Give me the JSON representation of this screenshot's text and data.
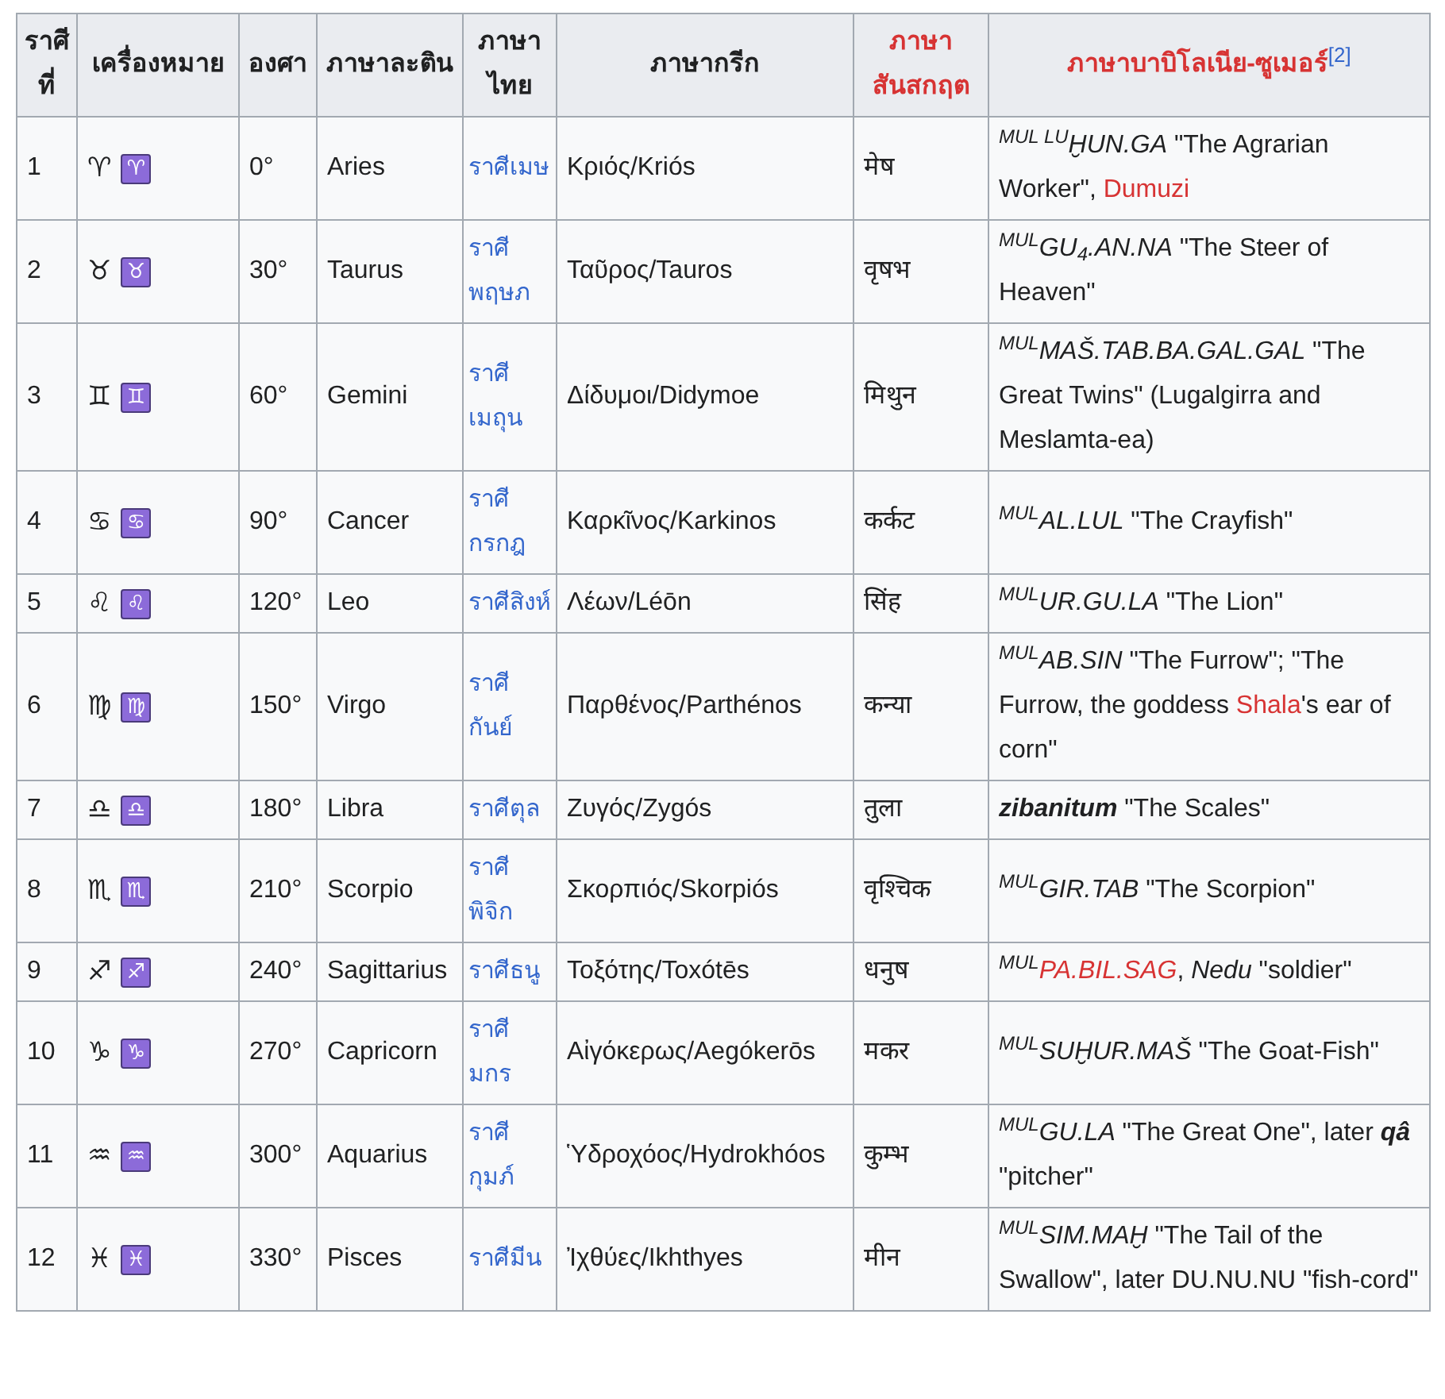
{
  "table": {
    "columns": [
      {
        "label": "ราศีที่",
        "kind": "plain"
      },
      {
        "label": "เครื่องหมาย",
        "kind": "plain"
      },
      {
        "label": "องศา",
        "kind": "plain"
      },
      {
        "label": "ภาษาละติน",
        "kind": "plain"
      },
      {
        "label": "ภาษาไทย",
        "kind": "plain"
      },
      {
        "label": "ภาษากรีก",
        "kind": "plain"
      },
      {
        "label": "ภาษาสันสกฤต",
        "kind": "redlink"
      },
      {
        "label": "ภาษาบาบิโลเนีย-ซูเมอร์",
        "kind": "redlink",
        "ref": "[2]"
      }
    ],
    "rows": [
      {
        "number": "1",
        "symbol": "♈",
        "emoji": "♈",
        "degree": "0°",
        "latin": "Aries",
        "thai": "ราศีเมษ",
        "greek": "Κριός/Kriós",
        "sanskrit": "मेष",
        "babylonian": [
          {
            "text": "MUL LU",
            "kind": "sup"
          },
          {
            "text": "ḪUN.GA",
            "kind": "italic"
          },
          {
            "text": " \"The Agrarian Worker\", ",
            "kind": "plain"
          },
          {
            "text": "Dumuzi",
            "kind": "link"
          }
        ]
      },
      {
        "number": "2",
        "symbol": "♉",
        "emoji": "♉",
        "degree": "30°",
        "latin": "Taurus",
        "thai": "ราศีพฤษภ",
        "greek": "Ταῦρος/Tauros",
        "sanskrit": "वृषभ",
        "babylonian": [
          {
            "text": "MUL",
            "kind": "sup"
          },
          {
            "text": "GU",
            "kind": "italic"
          },
          {
            "text": "4",
            "kind": "sub"
          },
          {
            "text": ".AN.NA",
            "kind": "italic"
          },
          {
            "text": " \"The Steer of Heaven\"",
            "kind": "plain"
          }
        ]
      },
      {
        "number": "3",
        "symbol": "♊",
        "emoji": "♊",
        "degree": "60°",
        "latin": "Gemini",
        "thai": "ราศีเมถุน",
        "greek": "Δίδυμοι/Didymoe",
        "sanskrit": "मिथुन",
        "babylonian": [
          {
            "text": "MUL",
            "kind": "sup"
          },
          {
            "text": "MAŠ.TAB.BA.GAL.GAL",
            "kind": "italic"
          },
          {
            "text": " \"The Great Twins\" (Lugalgirra and Meslamta-ea)",
            "kind": "plain"
          }
        ]
      },
      {
        "number": "4",
        "symbol": "♋",
        "emoji": "♋",
        "degree": "90°",
        "latin": "Cancer",
        "thai": "ราศีกรกฎ",
        "greek": "Καρκῖνος/Karkinos",
        "sanskrit": "कर्कट",
        "babylonian": [
          {
            "text": "MUL",
            "kind": "sup"
          },
          {
            "text": "AL.LUL",
            "kind": "italic"
          },
          {
            "text": " \"The Crayfish\"",
            "kind": "plain"
          }
        ]
      },
      {
        "number": "5",
        "symbol": "♌",
        "emoji": "♌",
        "degree": "120°",
        "latin": "Leo",
        "thai": "ราศีสิงห์",
        "greek": "Λέων/Léōn",
        "sanskrit": "सिंह",
        "babylonian": [
          {
            "text": "MUL",
            "kind": "sup"
          },
          {
            "text": "UR.GU.LA",
            "kind": "italic"
          },
          {
            "text": " \"The Lion\"",
            "kind": "plain"
          }
        ]
      },
      {
        "number": "6",
        "symbol": "♍",
        "emoji": "♍",
        "degree": "150°",
        "latin": "Virgo",
        "thai": "ราศีกันย์",
        "greek": "Παρθένος/Parthénos",
        "sanskrit": "कन्या",
        "babylonian": [
          {
            "text": "MUL",
            "kind": "sup"
          },
          {
            "text": "AB.SIN",
            "kind": "italic"
          },
          {
            "text": " \"The Furrow\"; \"The Furrow, the goddess ",
            "kind": "plain"
          },
          {
            "text": "Shala",
            "kind": "link"
          },
          {
            "text": "'s ear of corn\"",
            "kind": "plain"
          }
        ]
      },
      {
        "number": "7",
        "symbol": "♎",
        "emoji": "♎",
        "degree": "180°",
        "latin": "Libra",
        "thai": "ราศีตุล",
        "greek": "Ζυγός/Zygós",
        "sanskrit": "तुला",
        "babylonian": [
          {
            "text": "zibanitum",
            "kind": "bold_italic"
          },
          {
            "text": " \"The Scales\"",
            "kind": "plain"
          }
        ]
      },
      {
        "number": "8",
        "symbol": "♏",
        "emoji": "♏",
        "degree": "210°",
        "latin": "Scorpio",
        "thai": "ราศีพิจิก",
        "greek": "Σκορπιός/Skorpiós",
        "sanskrit": "वृश्चिक",
        "babylonian": [
          {
            "text": "MUL",
            "kind": "sup"
          },
          {
            "text": "GIR.TAB",
            "kind": "italic"
          },
          {
            "text": " \"The Scorpion\"",
            "kind": "plain"
          }
        ]
      },
      {
        "number": "9",
        "symbol": "♐",
        "emoji": "♐",
        "degree": "240°",
        "latin": "Sagittarius",
        "thai": "ราศีธนู",
        "greek": "Τοξότης/Toxótēs",
        "sanskrit": "धनुष",
        "babylonian": [
          {
            "text": "MUL",
            "kind": "sup"
          },
          {
            "text": "PA.BIL.SAG",
            "kind": "link_italic"
          },
          {
            "text": ", ",
            "kind": "plain"
          },
          {
            "text": "Nedu",
            "kind": "italic"
          },
          {
            "text": " \"soldier\"",
            "kind": "plain"
          }
        ]
      },
      {
        "number": "10",
        "symbol": "♑",
        "emoji": "♑",
        "degree": "270°",
        "latin": "Capricorn",
        "thai": "ราศีมกร",
        "greek": "Αἰγόκερως/Aegókerōs",
        "sanskrit": "मकर",
        "babylonian": [
          {
            "text": "MUL",
            "kind": "sup"
          },
          {
            "text": "SUḪUR.MAŠ",
            "kind": "italic"
          },
          {
            "text": " \"The Goat-Fish\"",
            "kind": "plain"
          }
        ]
      },
      {
        "number": "11",
        "symbol": "♒",
        "emoji": "♒",
        "degree": "300°",
        "latin": "Aquarius",
        "thai": "ราศีกุมภ์",
        "greek": "Ὑδροχόος/Hydrokhóos",
        "sanskrit": "कुम्भ",
        "babylonian": [
          {
            "text": "MUL",
            "kind": "sup"
          },
          {
            "text": "GU.LA",
            "kind": "italic"
          },
          {
            "text": " \"The Great One\", later ",
            "kind": "plain"
          },
          {
            "text": "qâ",
            "kind": "bold_italic"
          },
          {
            "text": " \"pitcher\"",
            "kind": "plain"
          }
        ]
      },
      {
        "number": "12",
        "symbol": "♓",
        "emoji": "♓",
        "degree": "330°",
        "latin": "Pisces",
        "thai": "ราศีมีน",
        "greek": "Ἰχθύες/Ikhthyes",
        "sanskrit": "मीन",
        "babylonian": [
          {
            "text": "MUL",
            "kind": "sup"
          },
          {
            "text": "SIM.MAḪ",
            "kind": "italic"
          },
          {
            "text": " \"The Tail of the Swallow\", later DU.NU.NU \"fish-cord\"",
            "kind": "plain"
          }
        ]
      }
    ]
  }
}
